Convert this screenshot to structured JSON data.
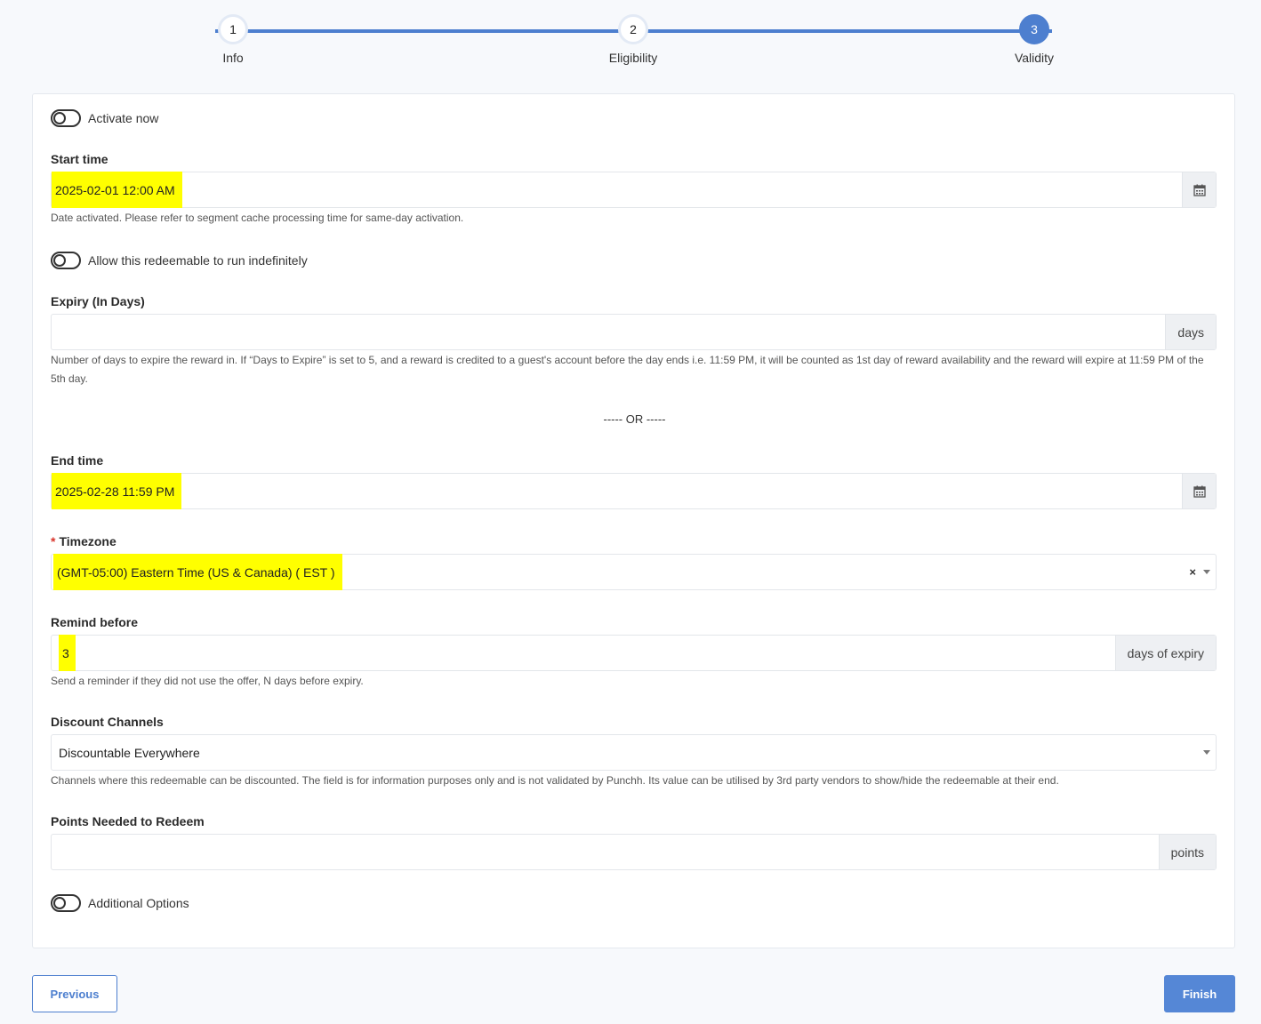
{
  "stepper": {
    "steps": [
      {
        "number": "1",
        "label": "Info"
      },
      {
        "number": "2",
        "label": "Eligibility"
      },
      {
        "number": "3",
        "label": "Validity"
      }
    ],
    "active_step": 3
  },
  "form": {
    "activate_now": {
      "label": "Activate now",
      "checked": false
    },
    "start_time": {
      "label": "Start time",
      "value": "2025-02-01 12:00 AM",
      "help": "Date activated. Please refer to segment cache processing time for same-day activation."
    },
    "run_indefinitely": {
      "label": "Allow this redeemable to run indefinitely",
      "checked": false
    },
    "expiry": {
      "label": "Expiry (In Days)",
      "value": "",
      "addon": "days",
      "help": "Number of days to expire the reward in. If “Days to Expire” is set to 5, and a reward is credited to a guest's account before the day ends i.e. 11:59 PM, it will be counted as 1st day of reward availability and the reward will expire at 11:59 PM of the 5th day."
    },
    "or_separator": "----- OR -----",
    "end_time": {
      "label": "End time",
      "value": "2025-02-28 11:59 PM"
    },
    "timezone": {
      "required_mark": "*",
      "label": "Timezone",
      "value": "(GMT-05:00) Eastern Time (US & Canada) ( EST )",
      "clear": "×"
    },
    "remind_before": {
      "label": "Remind before",
      "value": "3",
      "addon": "days of expiry",
      "help": "Send a reminder if they did not use the offer, N days before expiry."
    },
    "discount_channels": {
      "label": "Discount Channels",
      "value": "Discountable Everywhere",
      "help": "Channels where this redeemable can be discounted. The field is for information purposes only and is not validated by Punchh. Its value can be utilised by 3rd party vendors to show/hide the redeemable at their end."
    },
    "points_needed": {
      "label": "Points Needed to Redeem",
      "value": "",
      "addon": "points"
    },
    "additional_options": {
      "label": "Additional Options",
      "checked": false
    }
  },
  "actions": {
    "previous": "Previous",
    "finish": "Finish"
  },
  "colors": {
    "primary": "#4d7fcf",
    "highlight": "#ffff00",
    "required": "#d9342b"
  },
  "icons": {
    "calendar": "calendar-icon",
    "caret": "chevron-down-icon",
    "clear": "close-icon"
  }
}
